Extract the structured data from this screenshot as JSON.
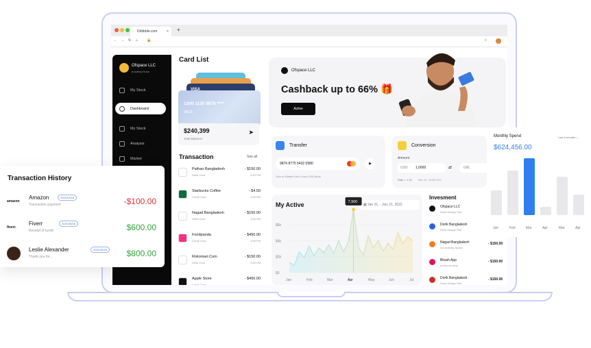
{
  "browser": {
    "tab_title": "Dribbble.com",
    "new_tab": "+"
  },
  "sidebar": {
    "brand": "Ofspace LLC",
    "brand_sub": "● Ashley Rose",
    "items": [
      {
        "label": "My Stock"
      },
      {
        "label": "Dashboard"
      },
      {
        "label": "My Stock"
      },
      {
        "label": "Analysis"
      },
      {
        "label": "Market"
      }
    ]
  },
  "card_list": {
    "title": "Card List",
    "card_number": "1200 1120 9876 ****",
    "expiry": "08/23",
    "card_brand": "VISA",
    "balance": "$240,399",
    "balance_label": "Total Balance"
  },
  "transaction": {
    "title": "Transaction",
    "see_all": "See all",
    "rows": [
      {
        "name": "Pathao Bangladesh",
        "sub": "Debit Card",
        "amount": "- $150.00",
        "time": "4:45 PM"
      },
      {
        "name": "Starbucks Coffee",
        "sub": "Credit Card",
        "amount": "- $4.50",
        "time": "4:45 PM"
      },
      {
        "name": "Nagad Bangladesh",
        "sub": "Debit Card",
        "amount": "- $150.00",
        "time": "4:45 PM"
      },
      {
        "name": "Foodpanda",
        "sub": "Credit Card",
        "amount": "- $450.00",
        "time": "4:45 PM"
      },
      {
        "name": "Rokomari.Com",
        "sub": "Debit Card",
        "amount": "- $150.00",
        "time": "4:45 PM"
      },
      {
        "name": "Apple Store",
        "sub": "Credit Card",
        "amount": "- $450.00",
        "time": ""
      }
    ]
  },
  "promo": {
    "company": "Ofspace LLC",
    "headline": "Cashback up to 66% 🎁",
    "button": "Active"
  },
  "transfer": {
    "title": "Transfer",
    "card_number": "9876 8775 5432 0980",
    "note": "Visa or MasterCard of any USA Bank"
  },
  "conversion": {
    "title": "Conversion",
    "amount_label": "Amount",
    "from_currency": "USD",
    "amount": "1,0000",
    "to_currency": "GBL",
    "rate": "Rate = 1.32",
    "rate_date": "Dec 21, 13:59 UTC"
  },
  "my_active": {
    "title": "My Active",
    "date_range": "Jan 21, - July 21, 2022",
    "tooltip": "7,900"
  },
  "chart_data": {
    "type": "area",
    "title": "My Active",
    "x": [
      "Jan",
      "Feb",
      "Mar",
      "Apr",
      "May",
      "Jun",
      "Jul"
    ],
    "y_ticks": [
      "$6k",
      "$4k",
      "$2k",
      "$0"
    ],
    "ylim": [
      0,
      6000
    ],
    "values": [
      1300,
      900,
      2600,
      1900,
      3300,
      2100,
      3100,
      2500,
      3500,
      2400,
      4000,
      2600,
      3900,
      7900,
      3200,
      2200,
      4600,
      3100,
      4000,
      2700,
      3700,
      2900,
      5000,
      3600,
      4500,
      4000
    ],
    "highlight": {
      "x": "Apr",
      "value": 7900
    },
    "accent": "#f2d24a"
  },
  "investment": {
    "title": "Invesment",
    "rows": [
      {
        "name": "Ofspace LLC",
        "sub": "Dorik Design Star",
        "amount": ""
      },
      {
        "name": "Dorik Bangladesh",
        "sub": "Dorik Design Star",
        "amount": ""
      },
      {
        "name": "Nagad Bangladesh",
        "sub": "Go-working Space",
        "amount": "- $150.00"
      },
      {
        "name": "Bkash App",
        "sub": "poorly mockup",
        "amount": "- $150.00"
      },
      {
        "name": "Dorik Bangladesh",
        "sub": "Dorik Design Star",
        "amount": "- $150.00"
      }
    ]
  },
  "monthly_spend": {
    "title": "Monthly Spend",
    "amount": "$624,456.00",
    "period": "Last 6 months",
    "chart_data": {
      "type": "bar",
      "categories": [
        "Jan",
        "Feb",
        "Mar",
        "Apr",
        "Mar",
        "Apr"
      ],
      "values": [
        32,
        58,
        74,
        11,
        50,
        27
      ],
      "highlight_index": 2,
      "highlight_color": "#2f7ff0"
    }
  },
  "history": {
    "title": "Transaction History",
    "rows": [
      {
        "logo": "amazon",
        "name": "Amazon",
        "date": "2021/03/18",
        "sub": "Transaction payment",
        "amount": "-$100.00",
        "color": "#e0313a"
      },
      {
        "logo": "fiverr.",
        "name": "Fiverr",
        "date": "2021/08/18",
        "sub": "Receipt of funds",
        "amount": "$600.00",
        "color": "#35a339"
      },
      {
        "logo": "",
        "name": "Leslie Alexander",
        "date": "2021/08/18",
        "sub": "Thank you for...",
        "amount": "$800.00",
        "color": "#35a339"
      }
    ]
  }
}
